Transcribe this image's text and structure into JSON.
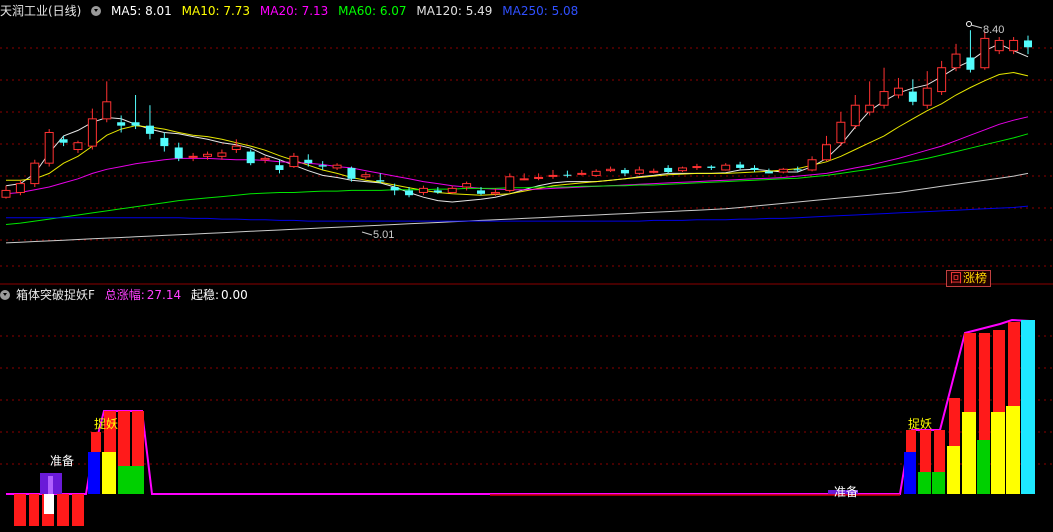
{
  "main_header": {
    "title": "天润工业(日线)",
    "ma5": "MA5: 8.01",
    "ma10": "MA10: 7.73",
    "ma20": "MA20: 7.13",
    "ma60": "MA60: 6.07",
    "ma120": "MA120: 5.49",
    "ma250": "MA250: 5.08"
  },
  "annotations": {
    "high": "8.40",
    "low": "5.01"
  },
  "zhangbang_button": {
    "icon": "回",
    "label": "涨榜"
  },
  "sub_header": {
    "title": "箱体突破捉妖F",
    "total_gain_label": "总涨幅:",
    "total_gain_value": "27.14",
    "qiwen_label": "起稳:",
    "qiwen_value": "0.00"
  },
  "sub_labels": {
    "zhunbei": "准备",
    "zhuoyao": "捉妖"
  },
  "colors": {
    "up": "#ff3232",
    "down": "#54fcfc",
    "ma5": "#ffffff",
    "ma10": "#ffff00",
    "ma20": "#ff00ff",
    "ma60": "#00ff00",
    "ma120": "#e0e0e0",
    "ma250": "#0000ff",
    "grid": "#8b0000"
  },
  "chart_data": {
    "type": "candlestick",
    "series": [
      {
        "name": "MA5",
        "values": [
          6.12,
          6.15,
          6.3,
          6.6,
          6.85,
          6.93,
          7.05,
          7.12,
          7.1,
          7.02,
          6.95,
          6.9,
          6.88,
          6.84,
          6.8,
          6.75,
          6.72,
          6.67,
          6.57,
          6.5,
          6.42,
          6.34,
          6.27,
          6.24,
          6.2,
          6.18,
          6.16,
          6.1,
          6.02,
          5.95,
          5.9,
          5.88,
          5.9,
          5.92,
          5.95,
          6.0,
          6.06,
          6.12,
          6.16,
          6.18,
          6.18,
          6.18,
          6.2,
          6.22,
          6.25,
          6.27,
          6.3,
          6.3,
          6.3,
          6.3,
          6.31,
          6.35,
          6.36,
          6.34,
          6.32,
          6.32,
          6.4,
          6.52,
          6.72,
          6.98,
          7.22,
          7.36,
          7.48,
          7.55,
          7.6,
          7.72,
          7.85,
          7.95,
          8.1,
          8.2,
          8.1,
          8.01
        ]
      },
      {
        "name": "MA10",
        "values": [
          6.2,
          6.2,
          6.22,
          6.3,
          6.45,
          6.55,
          6.7,
          6.86,
          6.95,
          7.0,
          6.98,
          6.95,
          6.9,
          6.86,
          6.84,
          6.8,
          6.75,
          6.7,
          6.64,
          6.56,
          6.49,
          6.42,
          6.35,
          6.3,
          6.24,
          6.2,
          6.17,
          6.13,
          6.09,
          6.05,
          6.02,
          6.0,
          5.99,
          5.98,
          5.99,
          6.0,
          6.04,
          6.08,
          6.12,
          6.14,
          6.16,
          6.18,
          6.2,
          6.22,
          6.24,
          6.26,
          6.28,
          6.29,
          6.3,
          6.3,
          6.3,
          6.31,
          6.32,
          6.33,
          6.35,
          6.37,
          6.42,
          6.47,
          6.55,
          6.65,
          6.75,
          6.85,
          6.98,
          7.1,
          7.22,
          7.32,
          7.45,
          7.56,
          7.66,
          7.75,
          7.78,
          7.73
        ]
      },
      {
        "name": "MA20",
        "values": [
          6.0,
          6.02,
          6.06,
          6.1,
          6.16,
          6.22,
          6.3,
          6.36,
          6.4,
          6.44,
          6.47,
          6.5,
          6.52,
          6.52,
          6.52,
          6.51,
          6.5,
          6.5,
          6.49,
          6.47,
          6.46,
          6.45,
          6.43,
          6.4,
          6.38,
          6.34,
          6.3,
          6.26,
          6.22,
          6.18,
          6.15,
          6.12,
          6.1,
          6.08,
          6.07,
          6.06,
          6.06,
          6.07,
          6.08,
          6.09,
          6.1,
          6.11,
          6.12,
          6.13,
          6.14,
          6.15,
          6.16,
          6.17,
          6.18,
          6.19,
          6.2,
          6.21,
          6.22,
          6.23,
          6.24,
          6.26,
          6.28,
          6.3,
          6.34,
          6.38,
          6.42,
          6.47,
          6.52,
          6.58,
          6.64,
          6.7,
          6.78,
          6.86,
          6.94,
          7.02,
          7.08,
          7.13
        ]
      },
      {
        "name": "MA60",
        "values": [
          5.55,
          5.57,
          5.6,
          5.63,
          5.66,
          5.69,
          5.72,
          5.75,
          5.78,
          5.81,
          5.84,
          5.87,
          5.9,
          5.92,
          5.94,
          5.96,
          5.98,
          6.0,
          6.01,
          6.02,
          6.02,
          6.03,
          6.04,
          6.04,
          6.05,
          6.05,
          6.05,
          6.06,
          6.06,
          6.06,
          6.07,
          6.07,
          6.08,
          6.08,
          6.08,
          6.09,
          6.09,
          6.1,
          6.1,
          6.1,
          6.11,
          6.11,
          6.12,
          6.12,
          6.13,
          6.13,
          6.14,
          6.15,
          6.16,
          6.17,
          6.18,
          6.19,
          6.2,
          6.21,
          6.22,
          6.23,
          6.25,
          6.27,
          6.3,
          6.33,
          6.36,
          6.4,
          6.44,
          6.48,
          6.52,
          6.57,
          6.62,
          6.67,
          6.72,
          6.77,
          6.82,
          6.88
        ]
      },
      {
        "name": "MA120",
        "values": [
          5.28,
          5.29,
          5.3,
          5.31,
          5.32,
          5.33,
          5.34,
          5.35,
          5.36,
          5.37,
          5.38,
          5.39,
          5.4,
          5.41,
          5.42,
          5.43,
          5.44,
          5.45,
          5.46,
          5.47,
          5.48,
          5.49,
          5.5,
          5.51,
          5.52,
          5.53,
          5.54,
          5.55,
          5.56,
          5.57,
          5.58,
          5.59,
          5.6,
          5.61,
          5.62,
          5.63,
          5.64,
          5.65,
          5.66,
          5.67,
          5.68,
          5.69,
          5.7,
          5.71,
          5.72,
          5.73,
          5.74,
          5.75,
          5.76,
          5.77,
          5.78,
          5.8,
          5.82,
          5.84,
          5.86,
          5.88,
          5.9,
          5.92,
          5.94,
          5.96,
          5.98,
          6.0,
          6.02,
          6.05,
          6.08,
          6.11,
          6.14,
          6.17,
          6.2,
          6.23,
          6.26,
          6.3
        ]
      },
      {
        "name": "MA250",
        "values": [
          5.65,
          5.65,
          5.65,
          5.65,
          5.65,
          5.65,
          5.65,
          5.65,
          5.65,
          5.65,
          5.65,
          5.65,
          5.65,
          5.64,
          5.64,
          5.63,
          5.63,
          5.62,
          5.62,
          5.61,
          5.61,
          5.6,
          5.6,
          5.6,
          5.6,
          5.6,
          5.6,
          5.6,
          5.6,
          5.6,
          5.6,
          5.6,
          5.6,
          5.6,
          5.6,
          5.6,
          5.6,
          5.6,
          5.6,
          5.6,
          5.6,
          5.6,
          5.6,
          5.6,
          5.6,
          5.61,
          5.61,
          5.61,
          5.62,
          5.62,
          5.62,
          5.63,
          5.63,
          5.64,
          5.64,
          5.65,
          5.66,
          5.67,
          5.68,
          5.69,
          5.7,
          5.71,
          5.72,
          5.73,
          5.74,
          5.75,
          5.76,
          5.77,
          5.78,
          5.79,
          5.8,
          5.82
        ]
      }
    ],
    "candles": [
      [
        5.95,
        6.05,
        6.12,
        5.93
      ],
      [
        6.02,
        6.15,
        6.2,
        5.98
      ],
      [
        6.15,
        6.45,
        6.5,
        6.1
      ],
      [
        6.45,
        6.9,
        6.95,
        6.4
      ],
      [
        6.8,
        6.75,
        6.85,
        6.7
      ],
      [
        6.65,
        6.75,
        6.78,
        6.6
      ],
      [
        6.7,
        7.1,
        7.25,
        6.65
      ],
      [
        7.1,
        7.35,
        7.65,
        7.05
      ],
      [
        7.05,
        7.0,
        7.15,
        6.9
      ],
      [
        7.05,
        7.0,
        7.45,
        6.95
      ],
      [
        7.0,
        6.88,
        7.3,
        6.8
      ],
      [
        6.82,
        6.7,
        6.9,
        6.62
      ],
      [
        6.68,
        6.52,
        6.75,
        6.48
      ],
      [
        6.55,
        6.55,
        6.6,
        6.48
      ],
      [
        6.55,
        6.58,
        6.62,
        6.5
      ],
      [
        6.55,
        6.6,
        6.65,
        6.5
      ],
      [
        6.65,
        6.7,
        6.8,
        6.6
      ],
      [
        6.62,
        6.45,
        6.65,
        6.42
      ],
      [
        6.5,
        6.52,
        6.55,
        6.45
      ],
      [
        6.42,
        6.35,
        6.5,
        6.3
      ],
      [
        6.4,
        6.55,
        6.6,
        6.38
      ],
      [
        6.5,
        6.45,
        6.58,
        6.4
      ],
      [
        6.42,
        6.4,
        6.48,
        6.35
      ],
      [
        6.38,
        6.42,
        6.45,
        6.35
      ],
      [
        6.38,
        6.22,
        6.4,
        6.18
      ],
      [
        6.25,
        6.28,
        6.32,
        6.22
      ],
      [
        6.2,
        6.18,
        6.3,
        6.15
      ],
      [
        6.1,
        6.05,
        6.15,
        5.98
      ],
      [
        6.05,
        5.98,
        6.1,
        5.95
      ],
      [
        6.02,
        6.08,
        6.12,
        5.98
      ],
      [
        6.05,
        6.02,
        6.1,
        6.0
      ],
      [
        6.02,
        6.08,
        6.12,
        6.0
      ],
      [
        6.1,
        6.15,
        6.18,
        6.05
      ],
      [
        6.05,
        6.0,
        6.1,
        5.98
      ],
      [
        6.0,
        6.02,
        6.08,
        5.97
      ],
      [
        6.05,
        6.25,
        6.3,
        6.02
      ],
      [
        6.22,
        6.22,
        6.3,
        6.2
      ],
      [
        6.24,
        6.24,
        6.3,
        6.2
      ],
      [
        6.27,
        6.27,
        6.35,
        6.22
      ],
      [
        6.28,
        6.27,
        6.34,
        6.24
      ],
      [
        6.3,
        6.3,
        6.35,
        6.27
      ],
      [
        6.27,
        6.33,
        6.36,
        6.25
      ],
      [
        6.34,
        6.36,
        6.4,
        6.32
      ],
      [
        6.35,
        6.3,
        6.38,
        6.26
      ],
      [
        6.3,
        6.35,
        6.4,
        6.28
      ],
      [
        6.33,
        6.33,
        6.37,
        6.3
      ],
      [
        6.38,
        6.32,
        6.42,
        6.3
      ],
      [
        6.34,
        6.38,
        6.4,
        6.32
      ],
      [
        6.4,
        6.4,
        6.44,
        6.35
      ],
      [
        6.4,
        6.38,
        6.42,
        6.35
      ],
      [
        6.35,
        6.42,
        6.45,
        6.34
      ],
      [
        6.43,
        6.38,
        6.47,
        6.36
      ],
      [
        6.38,
        6.35,
        6.42,
        6.32
      ],
      [
        6.33,
        6.3,
        6.37,
        6.3
      ],
      [
        6.32,
        6.36,
        6.38,
        6.3
      ],
      [
        6.36,
        6.35,
        6.4,
        6.32
      ],
      [
        6.35,
        6.5,
        6.55,
        6.33
      ],
      [
        6.5,
        6.72,
        6.85,
        6.48
      ],
      [
        6.75,
        7.05,
        7.2,
        6.7
      ],
      [
        7.0,
        7.3,
        7.45,
        6.95
      ],
      [
        7.2,
        7.3,
        7.65,
        7.15
      ],
      [
        7.3,
        7.5,
        7.85,
        7.25
      ],
      [
        7.45,
        7.55,
        7.7,
        7.4
      ],
      [
        7.5,
        7.35,
        7.68,
        7.3
      ],
      [
        7.3,
        7.55,
        7.8,
        7.25
      ],
      [
        7.5,
        7.85,
        7.95,
        7.45
      ],
      [
        7.85,
        8.05,
        8.2,
        7.8
      ],
      [
        8.0,
        7.82,
        8.4,
        7.78
      ],
      [
        7.85,
        8.28,
        8.38,
        7.82
      ],
      [
        8.1,
        8.25,
        8.3,
        8.05
      ],
      [
        8.1,
        8.25,
        8.3,
        8.05
      ],
      [
        8.25,
        8.15,
        8.32,
        8.05
      ]
    ],
    "indicator_bars": {
      "red_stack": [
        0,
        0,
        0,
        0,
        0,
        0,
        0,
        0,
        0,
        0,
        0,
        0,
        0,
        0,
        0,
        0,
        0,
        0,
        0,
        0,
        0,
        0,
        0,
        0,
        0,
        0,
        0,
        0,
        0,
        0,
        0,
        0,
        0,
        0,
        0,
        0,
        0,
        0,
        0,
        0,
        0,
        0,
        0,
        0,
        0,
        0,
        0,
        0,
        0,
        0,
        0,
        0,
        0,
        0,
        0,
        0,
        0,
        0,
        0,
        0,
        0,
        0,
        0,
        0,
        0,
        0,
        0,
        0,
        0,
        0,
        0,
        0
      ],
      "note": "lower pane drawn from signal arrays"
    }
  }
}
